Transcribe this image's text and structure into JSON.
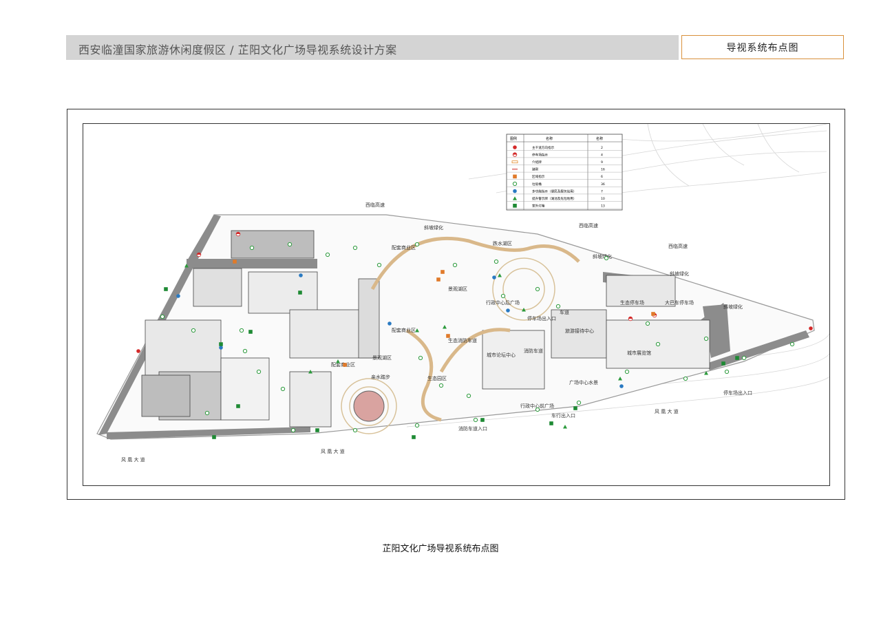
{
  "header": {
    "title": "西安临潼国家旅游休闲度假区 / 芷阳文化广场导视系统设计方案",
    "section_label": "导视系统布点图"
  },
  "caption": "芷阳文化广场导视系统布点图",
  "legend": {
    "headers": [
      "图例",
      "名称",
      "名称"
    ],
    "rows": [
      {
        "icon": "red-circle",
        "name": "主干道方向指示",
        "count": "2"
      },
      {
        "icon": "half-red-circle",
        "name": "停车场指示",
        "count": "4"
      },
      {
        "icon": "orange-outline-rect",
        "name": "介绍牌",
        "count": "9"
      },
      {
        "icon": "pink-dash",
        "name": "踏帮",
        "count": "16"
      },
      {
        "icon": "orange-square",
        "name": "区域指示",
        "count": "6"
      },
      {
        "icon": "green-ring",
        "name": "垃圾桶",
        "count": "36"
      },
      {
        "icon": "blue-circle",
        "name": "多功能指示（便民及服务站用）",
        "count": "7"
      },
      {
        "icon": "green-triangle",
        "name": "提升警示牌（湖池及危险地用）",
        "count": "10"
      },
      {
        "icon": "green-square",
        "name": "室外灯箱",
        "count": "13"
      }
    ]
  },
  "map_labels": {
    "xilin_expressway_1": "西临高速",
    "xilin_expressway_2": "西临高速",
    "xilin_expressway_3": "西临高速",
    "slope_green_1": "斜坡绿化",
    "slope_green_2": "斜坡绿化",
    "slope_green_3": "斜坡绿化",
    "slope_green_4": "斜坡绿化",
    "diedou_lake": "跌水湖区",
    "scenic_lake_1": "景观湖区",
    "scenic_lake_2": "景观湖区",
    "admin_rear_plaza": "行政中心后广场",
    "admin_front_plaza": "行政中心前广场",
    "eco_park": "生态园区",
    "city_forum": "城市论坛中心",
    "tourism_reception": "旅游接待中心",
    "city_exhibition": "城市展览馆",
    "plaza_water": "广场中心水景",
    "eco_parking": "生态停车场",
    "bus_parking": "大巴车停车场",
    "fengxiong_1": "风 凰 大 道",
    "fengxiong_2": "风 凰 大 道",
    "fengxiong_3": "风 凰 大 道",
    "fire_lane_1": "消防车道",
    "fire_lane_2": "消防车道入口",
    "parking_entrance": "停车场出入口",
    "vehicle_entrance": "车行出入口",
    "parking_entry_2": "停车场出入口",
    "lane_1": "车道",
    "water_plaza": "亲水踏步",
    "commercial_1": "配套商业区",
    "commercial_2": "配套商业区",
    "commercial_3": "配套商业区",
    "eco_fire_lane": "生态消防车道"
  }
}
